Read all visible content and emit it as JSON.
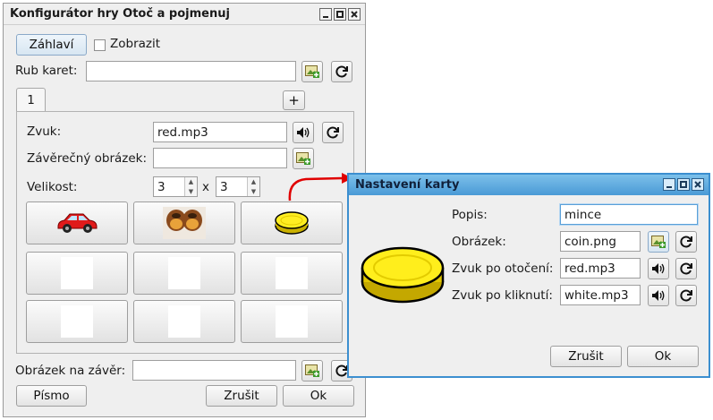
{
  "main_window": {
    "title": "Konfigurátor hry Otoč a pojmenuj",
    "header_button": "Záhlaví",
    "show_checkbox_label": "Zobrazit",
    "card_back_label": "Rub karet:",
    "card_back_value": "",
    "tab_label": "1",
    "add_tab_label": "+",
    "sound_label": "Zvuk:",
    "sound_value": "red.mp3",
    "final_image_label": "Závěrečný obrázek:",
    "final_image_value": "",
    "size_label": "Velikost:",
    "size_rows": "3",
    "size_times": "x",
    "size_cols": "3",
    "end_image_label": "Obrázek na závěr:",
    "end_image_value": "",
    "font_button": "Písmo",
    "cancel_button": "Zrušit",
    "ok_button": "Ok",
    "grid_cells": [
      "car-image",
      "cookies-image",
      "coin-image",
      "",
      "",
      "",
      "",
      "",
      ""
    ]
  },
  "dialog": {
    "title": "Nastavení karty",
    "description_label": "Popis:",
    "description_value": "mince",
    "image_label": "Obrázek:",
    "image_value": "coin.png",
    "flip_sound_label": "Zvuk po otočení:",
    "flip_sound_value": "red.mp3",
    "click_sound_label": "Zvuk po kliknutí:",
    "click_sound_value": "white.mp3",
    "cancel_button": "Zrušit",
    "ok_button": "Ok"
  },
  "colors": {
    "dialog_titlebar": "#5aa9dc",
    "dialog_border": "#3c8fd0",
    "arrow": "#e00000",
    "window_bg": "#efefef"
  }
}
